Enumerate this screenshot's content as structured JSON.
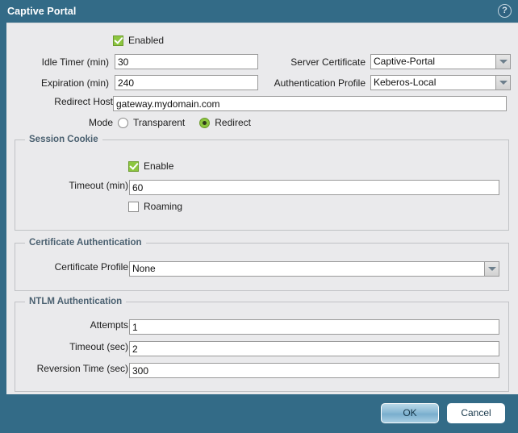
{
  "window": {
    "title": "Captive Portal",
    "help_icon": "help-circle-icon",
    "help_glyph": "?"
  },
  "general": {
    "enabled": {
      "label": "Enabled",
      "checked": true
    },
    "idle_timer": {
      "label": "Idle Timer (min)",
      "value": "30"
    },
    "expiration": {
      "label": "Expiration (min)",
      "value": "240"
    },
    "redirect_host": {
      "label": "Redirect Host",
      "value": "gateway.mydomain.com"
    },
    "server_certificate": {
      "label": "Server Certificate",
      "value": "Captive-Portal"
    },
    "authentication_profile": {
      "label": "Authentication Profile",
      "value": "Keberos-Local"
    },
    "mode": {
      "label": "Mode",
      "options": [
        "Transparent",
        "Redirect"
      ],
      "selected": "Redirect"
    }
  },
  "session_cookie": {
    "title": "Session Cookie",
    "enable": {
      "label": "Enable",
      "checked": true
    },
    "timeout": {
      "label": "Timeout (min)",
      "value": "60"
    },
    "roaming": {
      "label": "Roaming",
      "checked": false
    }
  },
  "certificate_authentication": {
    "title": "Certificate Authentication",
    "certificate_profile": {
      "label": "Certificate Profile",
      "value": "None"
    }
  },
  "ntlm_authentication": {
    "title": "NTLM Authentication",
    "attempts": {
      "label": "Attempts",
      "value": "1"
    },
    "timeout": {
      "label": "Timeout (sec)",
      "value": "2"
    },
    "reversion_time": {
      "label": "Reversion Time (sec)",
      "value": "300"
    }
  },
  "footer": {
    "ok_label": "OK",
    "cancel_label": "Cancel"
  },
  "theme": {
    "chrome": "#336b87",
    "panel": "#eaeaec",
    "accent_green": "#8cc63f",
    "group_title": "#4a6070"
  }
}
